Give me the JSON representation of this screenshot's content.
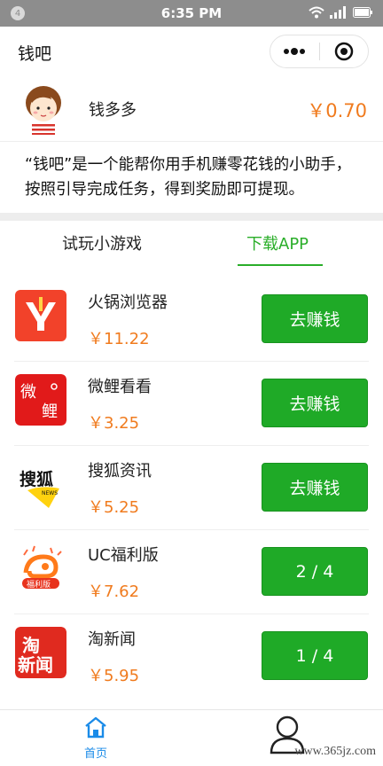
{
  "status_bar": {
    "notification_count": "4",
    "time": "6:35 PM"
  },
  "nav": {
    "title": "钱吧"
  },
  "user": {
    "name": "钱多多",
    "balance": "￥0.70"
  },
  "intro": "“钱吧”是一个能帮你用手机赚零花钱的小助手，按照引导完成任务，得到奖励即可提现。",
  "tabs": [
    {
      "label": "试玩小游戏",
      "active": false
    },
    {
      "label": "下载APP",
      "active": true
    }
  ],
  "apps": [
    {
      "name": "火锅浏览器",
      "reward": "￥11.22",
      "button": "去赚钱",
      "icon": "huoguo-browser-logo"
    },
    {
      "name": "微鲤看看",
      "reward": "￥3.25",
      "button": "去赚钱",
      "icon": "weili-kankan-logo"
    },
    {
      "name": "搜狐资讯",
      "reward": "￥5.25",
      "button": "去赚钱",
      "icon": "sohu-news-logo"
    },
    {
      "name": "UC福利版",
      "reward": "￥7.62",
      "button": "2 / 4",
      "icon": "uc-fuli-logo"
    },
    {
      "name": "淘新闻",
      "reward": "￥5.95",
      "button": "1 / 4",
      "icon": "tao-news-logo"
    }
  ],
  "tabbar": {
    "home_label": "首页"
  },
  "watermark": "www.365jz.com",
  "colors": {
    "accent_green": "#1faa27",
    "price_orange": "#f07b1e",
    "tab_blue": "#1a8be8"
  }
}
